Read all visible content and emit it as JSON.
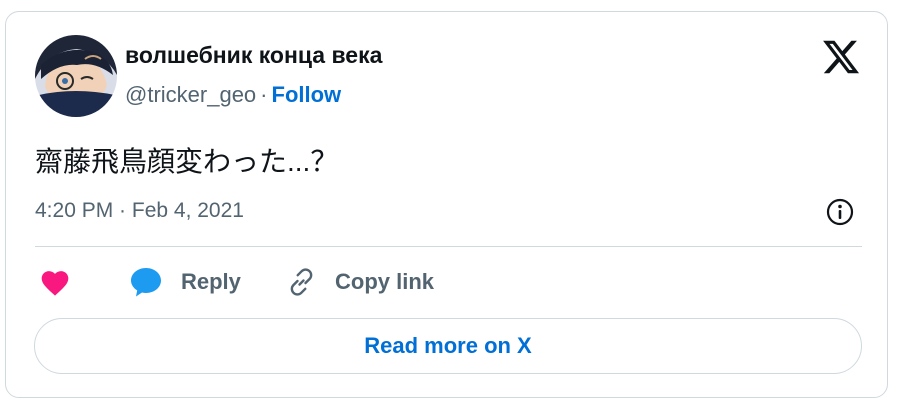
{
  "author": {
    "display_name": "волшебник конца века",
    "handle": "@tricker_geo",
    "separator": "·",
    "follow_label": "Follow"
  },
  "tweet": {
    "text": "齋藤飛鳥顔変わった...？",
    "timestamp": "4:20 PM · Feb 4, 2021"
  },
  "actions": {
    "like_icon": "heart-icon",
    "reply_label": "Reply",
    "copy_label": "Copy link"
  },
  "read_more_label": "Read more on X",
  "colors": {
    "like": "#f91880",
    "reply": "#1d9bf0",
    "link": "#006fd6",
    "muted": "#536471",
    "text": "#0f1419",
    "border": "#cfd9de"
  }
}
